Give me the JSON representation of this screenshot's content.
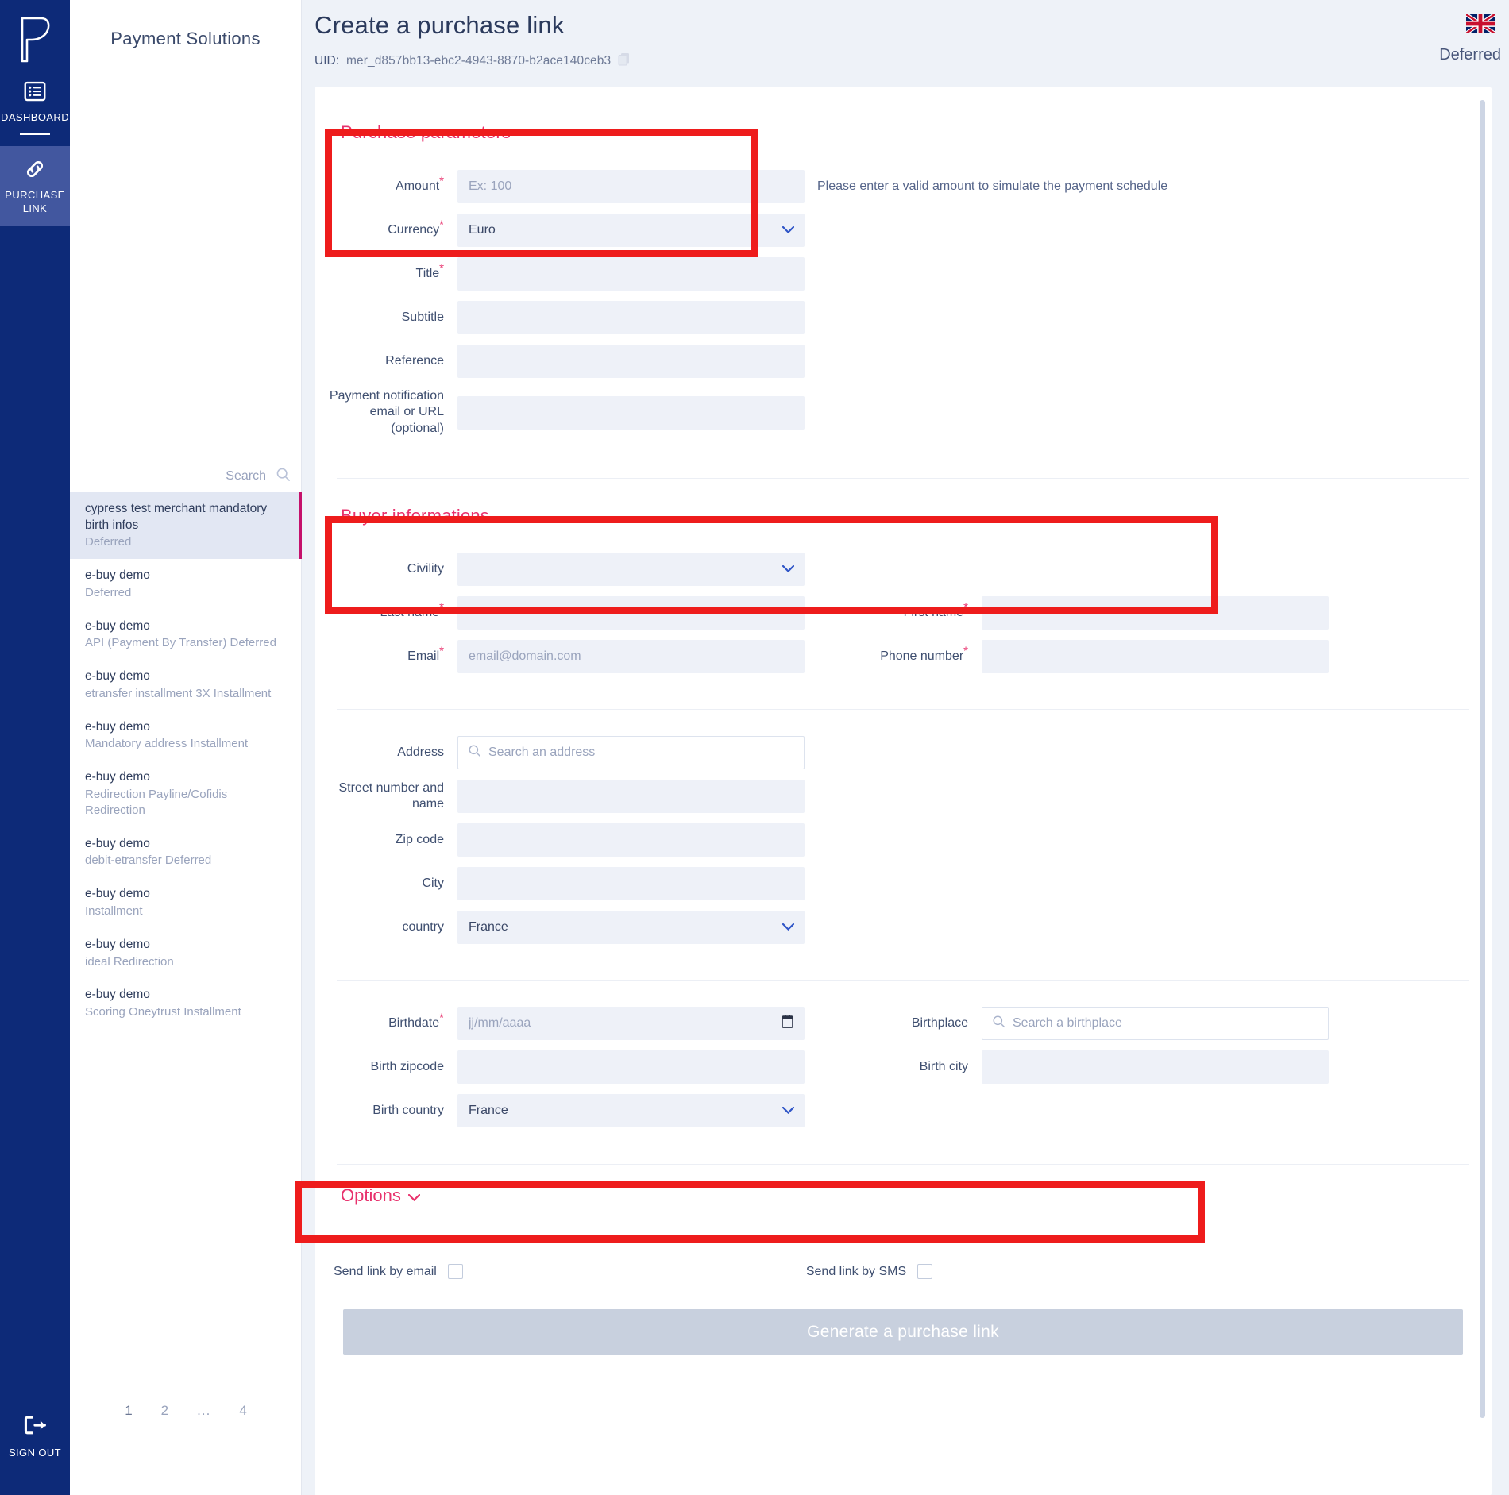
{
  "rail": {
    "logo_icon": "payment-logo-icon",
    "items": [
      {
        "id": "dashboard",
        "label": "DASHBOARD",
        "icon": "list-panel-icon",
        "active": false
      },
      {
        "id": "purchase-link",
        "label": "PURCHASE LINK",
        "icon": "chain-link-icon",
        "active": true
      }
    ],
    "sign_out": {
      "label": "SIGN OUT",
      "icon": "sign-out-icon"
    }
  },
  "sidebar": {
    "brand_title": "Payment Solutions",
    "search_placeholder": "Search",
    "search_value": "",
    "search_icon": "search-icon",
    "merchants": [
      {
        "name": "cypress test merchant mandatory birth infos",
        "sub": "Deferred",
        "selected": true
      },
      {
        "name": "e-buy demo",
        "sub": "Deferred",
        "selected": false
      },
      {
        "name": "e-buy demo",
        "sub": "API (Payment By Transfer) Deferred",
        "selected": false
      },
      {
        "name": "e-buy demo",
        "sub": "etransfer installment 3X Installment",
        "selected": false
      },
      {
        "name": "e-buy demo",
        "sub": "Mandatory address Installment",
        "selected": false
      },
      {
        "name": "e-buy demo",
        "sub": "Redirection Payline/Cofidis Redirection",
        "selected": false
      },
      {
        "name": "e-buy demo",
        "sub": "debit-etransfer Deferred",
        "selected": false
      },
      {
        "name": "e-buy demo",
        "sub": "Installment",
        "selected": false
      },
      {
        "name": "e-buy demo",
        "sub": "ideal Redirection",
        "selected": false
      },
      {
        "name": "e-buy demo",
        "sub": "Scoring Oneytrust Installment",
        "selected": false
      }
    ],
    "pagination": [
      {
        "label": "1",
        "current": true
      },
      {
        "label": "2",
        "current": false
      },
      {
        "label": "...",
        "current": false
      },
      {
        "label": "4",
        "current": false
      }
    ]
  },
  "header": {
    "title": "Create a purchase link",
    "uid_label": "UID:",
    "uid_value": "mer_d857bb13-ebc2-4943-8870-b2ace140ceb3",
    "copy_icon": "copy-icon",
    "flag_icon": "uk-flag-icon",
    "status": "Deferred"
  },
  "purchase": {
    "section_title": "Purchase parameters",
    "amount": {
      "label": "Amount",
      "required": true,
      "placeholder": "Ex: 100",
      "value": ""
    },
    "amount_hint": "Please enter a valid amount to simulate the payment schedule",
    "currency": {
      "label": "Currency",
      "required": true,
      "value": "Euro",
      "options": [
        "Euro"
      ]
    },
    "title": {
      "label": "Title",
      "required": true,
      "placeholder": "",
      "value": ""
    },
    "subtitle": {
      "label": "Subtitle",
      "required": false,
      "placeholder": "",
      "value": ""
    },
    "reference": {
      "label": "Reference",
      "required": false,
      "placeholder": "",
      "value": ""
    },
    "notification": {
      "label": "Payment notification email or URL (optional)",
      "required": false,
      "placeholder": "",
      "value": ""
    }
  },
  "buyer": {
    "section_title": "Buyer informations",
    "civility": {
      "label": "Civility",
      "required": false,
      "value": "",
      "options": []
    },
    "last_name": {
      "label": "Last name",
      "required": true,
      "placeholder": "",
      "value": ""
    },
    "first_name": {
      "label": "First name",
      "required": true,
      "placeholder": "",
      "value": ""
    },
    "email": {
      "label": "Email",
      "required": true,
      "placeholder": "email@domain.com",
      "value": ""
    },
    "phone": {
      "label": "Phone number",
      "required": true,
      "placeholder": "",
      "value": ""
    },
    "address": {
      "label": "Address",
      "required": false,
      "placeholder": "Search an address",
      "value": "",
      "icon": "search-icon"
    },
    "street": {
      "label": "Street number and name",
      "required": false,
      "placeholder": "",
      "value": ""
    },
    "zip": {
      "label": "Zip code",
      "required": false,
      "placeholder": "",
      "value": ""
    },
    "city": {
      "label": "City",
      "required": false,
      "placeholder": "",
      "value": ""
    },
    "country": {
      "label": "country",
      "required": false,
      "value": "France",
      "options": [
        "France"
      ]
    },
    "birthdate": {
      "label": "Birthdate",
      "required": true,
      "placeholder": "jj/mm/aaaa",
      "value": "",
      "icon": "calendar-icon"
    },
    "birthplace": {
      "label": "Birthplace",
      "required": false,
      "placeholder": "Search a birthplace",
      "value": "",
      "icon": "search-icon"
    },
    "birth_zipcode": {
      "label": "Birth zipcode",
      "required": false,
      "placeholder": "",
      "value": ""
    },
    "birth_city": {
      "label": "Birth city",
      "required": false,
      "placeholder": "",
      "value": ""
    },
    "birth_country": {
      "label": "Birth country",
      "required": false,
      "value": "France",
      "options": [
        "France"
      ]
    }
  },
  "options": {
    "title": "Options",
    "chevron_icon": "chevron-down-icon",
    "send_email": {
      "label": "Send link by email",
      "checked": false
    },
    "send_sms": {
      "label": "Send link by SMS",
      "checked": false
    }
  },
  "submit": {
    "label": "Generate a purchase link",
    "enabled": false
  },
  "colors": {
    "rail_bg": "#0d2a78",
    "rail_active": "#42579f",
    "accent_pink": "#e8326d",
    "selected_border": "#c5116b",
    "field_bg": "#eef1f8",
    "page_bg": "#eef2f8",
    "highlight_box": "#ee1c1c",
    "submit_bg": "#c8d0de"
  }
}
